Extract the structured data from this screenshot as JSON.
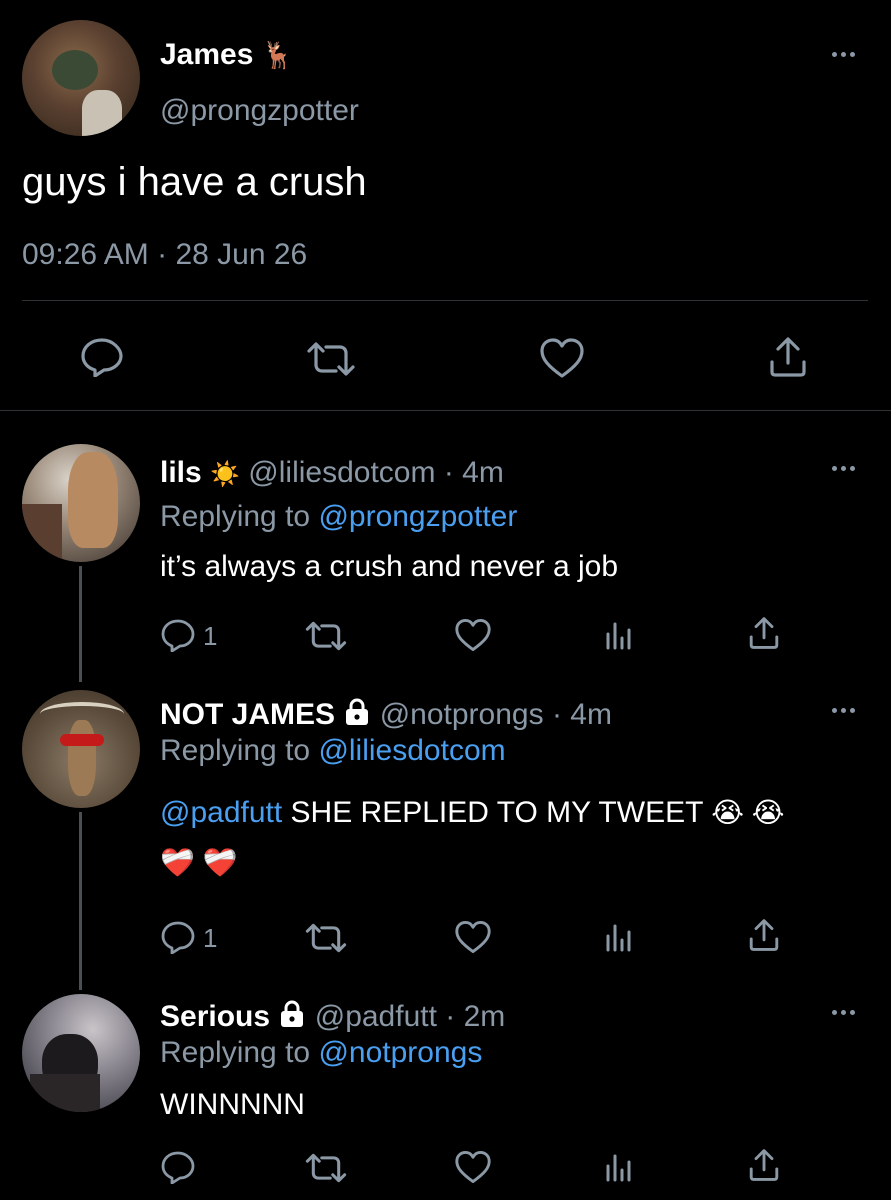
{
  "main_tweet": {
    "display_name": "James",
    "name_emoji": "🦌",
    "handle": "@prongzpotter",
    "text": "guys i have a crush",
    "time": "09:26 AM",
    "separator": "·",
    "date": "28 Jun 26"
  },
  "replies": [
    {
      "display_name": "lils",
      "name_emoji": "☀️",
      "handle": "@liliesdotcom",
      "age": "· 4m",
      "replying_label": "Replying to",
      "replying_to": "@prongzpotter",
      "text": "it’s always a crush and never a job",
      "reply_count": "1"
    },
    {
      "display_name": "NOT JAMES",
      "handle": "@notprongs",
      "age": "· 4m",
      "replying_label": "Replying to",
      "replying_to": "@liliesdotcom",
      "mention": "@padfutt",
      "text": " SHE REPLIED TO MY TWEET",
      "emoji_line1": "😭 😭",
      "emoji_line2": "❤️‍🩹 ❤️‍🩹",
      "reply_count": "1"
    },
    {
      "display_name": "Serious",
      "handle": "@padfutt",
      "age": "· 2m",
      "replying_label": "Replying to",
      "replying_to": "@notprongs",
      "text": "WINNNNN"
    }
  ],
  "colors": {
    "background": "#000000",
    "secondary_text": "#8b98a5",
    "link": "#4a9ff0",
    "divider": "#2f3336"
  }
}
